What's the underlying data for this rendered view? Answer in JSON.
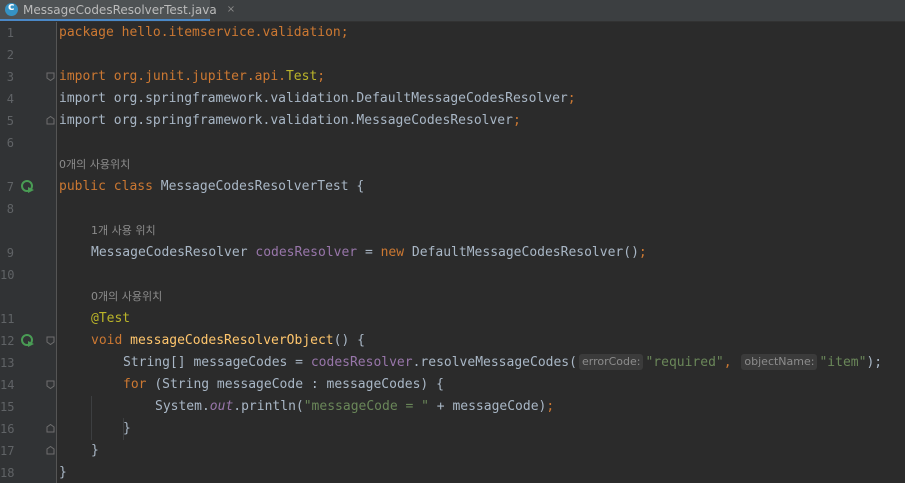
{
  "tab": {
    "filename": "MessageCodesResolverTest.java",
    "close": "×"
  },
  "lines": {
    "l1": "package hello.itemservice.validation;",
    "l3_a": "import org.junit.jupiter.api.",
    "l3_b": "Test",
    "l3_c": ";",
    "l4_a": "import org.springframework.validation.DefaultMessageCodesResolver",
    "l4_b": ";",
    "l5_a": "import org.springframework.validation.MessageCodesResolver",
    "l5_b": ";",
    "usage_top": "0개의 사용위치",
    "l7_a": "public class ",
    "l7_b": "MessageCodesResolverTest {",
    "usage_field": "1개 사용 위치",
    "l9_a": "MessageCodesResolver ",
    "l9_b": "codesResolver",
    "l9_c": " = ",
    "l9_d": "new ",
    "l9_e": "DefaultMessageCodesResolver()",
    "l9_f": ";",
    "usage_method": "0개의 사용위치",
    "l11": "@Test",
    "l12_a": "void ",
    "l12_b": "messageCodesResolverObject",
    "l12_c": "() {",
    "l13_a": "String[] messageCodes = ",
    "l13_b": "codesResolver",
    "l13_c": ".resolveMessageCodes(",
    "l13_hint1": "errorCode:",
    "l13_d": "\"required\"",
    "l13_e": ",",
    "l13_hint2": "objectName:",
    "l13_f": "\"item\"",
    "l13_g": ");",
    "l14_a": "for ",
    "l14_b": "(String messageCode : messageCodes) {",
    "l15_a": "System.",
    "l15_b": "out",
    "l15_c": ".println(",
    "l15_d": "\"messageCode = \"",
    "l15_e": " + messageCode)",
    "l15_f": ";",
    "l16": "}",
    "l17": "}",
    "l18": "}"
  },
  "line_numbers": [
    "1",
    "2",
    "3",
    "4",
    "5",
    "6",
    "7",
    "8",
    "9",
    "10",
    "11",
    "12",
    "13",
    "14",
    "15",
    "16",
    "17",
    "18"
  ],
  "icons": {
    "run": "run-test-icon",
    "fold": "fold-marker-icon",
    "file": "java-class-icon"
  },
  "colors": {
    "background": "#2b2b2b",
    "keyword": "#cc7832",
    "annotation": "#bbb529",
    "string": "#6a8759",
    "field": "#9876aa",
    "method": "#ffc66d",
    "text": "#a9b7c6",
    "line_number": "#606366"
  }
}
